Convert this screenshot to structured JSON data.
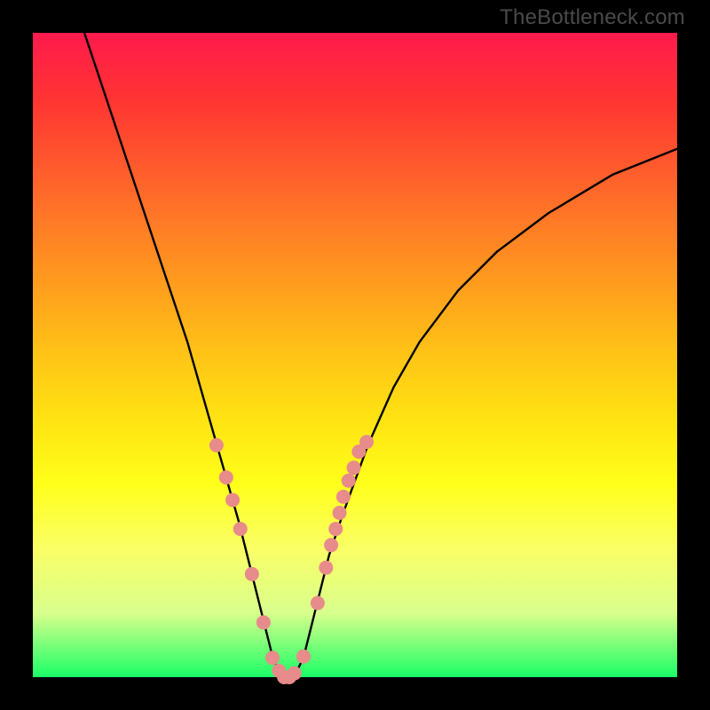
{
  "watermark": "TheBottleneck.com",
  "colors": {
    "curve": "#000000",
    "marker_fill": "#e88b8b",
    "marker_stroke": "#c86868",
    "bg_black": "#000000",
    "gradient_top": "#ff1a4d",
    "gradient_bottom": "#1aff66"
  },
  "chart_data": {
    "type": "line",
    "title": "",
    "xlabel": "",
    "ylabel": "",
    "xlim": [
      0,
      100
    ],
    "ylim": [
      0,
      100
    ],
    "grid": false,
    "legend": false,
    "series": [
      {
        "name": "bottleneck-curve",
        "x": [
          8,
          12,
          16,
          20,
          24,
          28,
          30,
          32,
          33,
          34,
          35,
          36,
          37,
          38,
          39,
          40,
          41,
          42,
          43,
          44,
          46,
          48,
          52,
          56,
          60,
          66,
          72,
          80,
          90,
          100
        ],
        "y": [
          100,
          88,
          76,
          64,
          52,
          38,
          31,
          24,
          20,
          16,
          12,
          8,
          4,
          1,
          0,
          0,
          1,
          3,
          7,
          11,
          19,
          25,
          36,
          45,
          52,
          60,
          66,
          72,
          78,
          82
        ]
      }
    ],
    "markers": {
      "name": "highlighted-points",
      "x": [
        28.5,
        30.0,
        31.0,
        32.2,
        34.0,
        35.8,
        37.2,
        38.2,
        39.0,
        39.8,
        40.6,
        42.0,
        44.2,
        45.5,
        46.3,
        47.0,
        47.6,
        48.2,
        49.0,
        49.8,
        50.6,
        51.8
      ],
      "y": [
        36.0,
        31.0,
        27.5,
        23.0,
        16.0,
        8.5,
        3.0,
        1.0,
        0.0,
        0.0,
        0.6,
        3.2,
        11.5,
        17.0,
        20.5,
        23.0,
        25.5,
        28.0,
        30.5,
        32.5,
        35.0,
        36.5
      ]
    }
  }
}
